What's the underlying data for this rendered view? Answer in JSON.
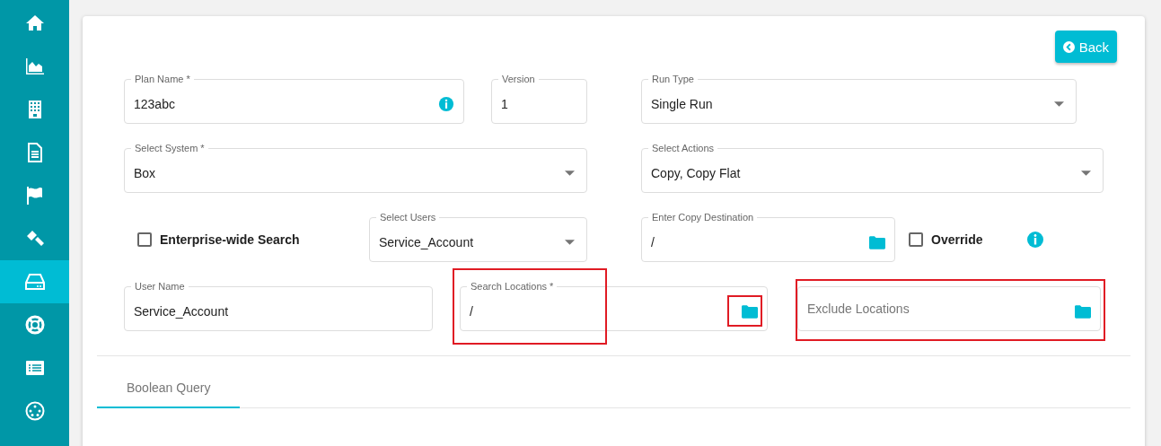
{
  "sidebar": {
    "items": [
      {
        "selected": false
      },
      {
        "selected": false
      },
      {
        "selected": false
      },
      {
        "selected": false
      },
      {
        "selected": false
      },
      {
        "selected": false
      },
      {
        "selected": true
      },
      {
        "selected": false
      },
      {
        "selected": false
      },
      {
        "selected": false
      }
    ]
  },
  "back_button": {
    "label": "Back"
  },
  "form_rows": [
    [
      {
        "kind": "text",
        "label": "Plan Name *",
        "value": "123abc",
        "info": true
      },
      {
        "kind": "text",
        "label": "Version",
        "value": "1"
      },
      {
        "kind": "select",
        "label": "Run Type",
        "value": "Single Run"
      }
    ],
    [
      {
        "kind": "select",
        "label": "Select System *",
        "value": "Box"
      },
      {
        "kind": "select",
        "label": "Select Actions",
        "value": "Copy, Copy Flat"
      }
    ],
    [
      {
        "kind": "checkbox",
        "label": "Enterprise-wide Search",
        "checked": false
      },
      {
        "kind": "select",
        "label": "Select Users",
        "value": "Service_Account"
      },
      {
        "kind": "folder",
        "label": "Enter Copy Destination",
        "value": "/"
      },
      {
        "kind": "checkbox",
        "label": "Override",
        "checked": false,
        "info": true
      }
    ],
    [
      {
        "kind": "text",
        "label": "User Name",
        "value": "Service_Account"
      },
      {
        "kind": "folder",
        "label": "Search Locations *",
        "value": "/",
        "annotated": true,
        "icon_annotated": true
      },
      {
        "kind": "folder",
        "placeholder": "Exclude Locations",
        "annotated": true
      }
    ]
  ],
  "tabs": [
    {
      "label": "Boolean Query",
      "selected": true
    }
  ]
}
